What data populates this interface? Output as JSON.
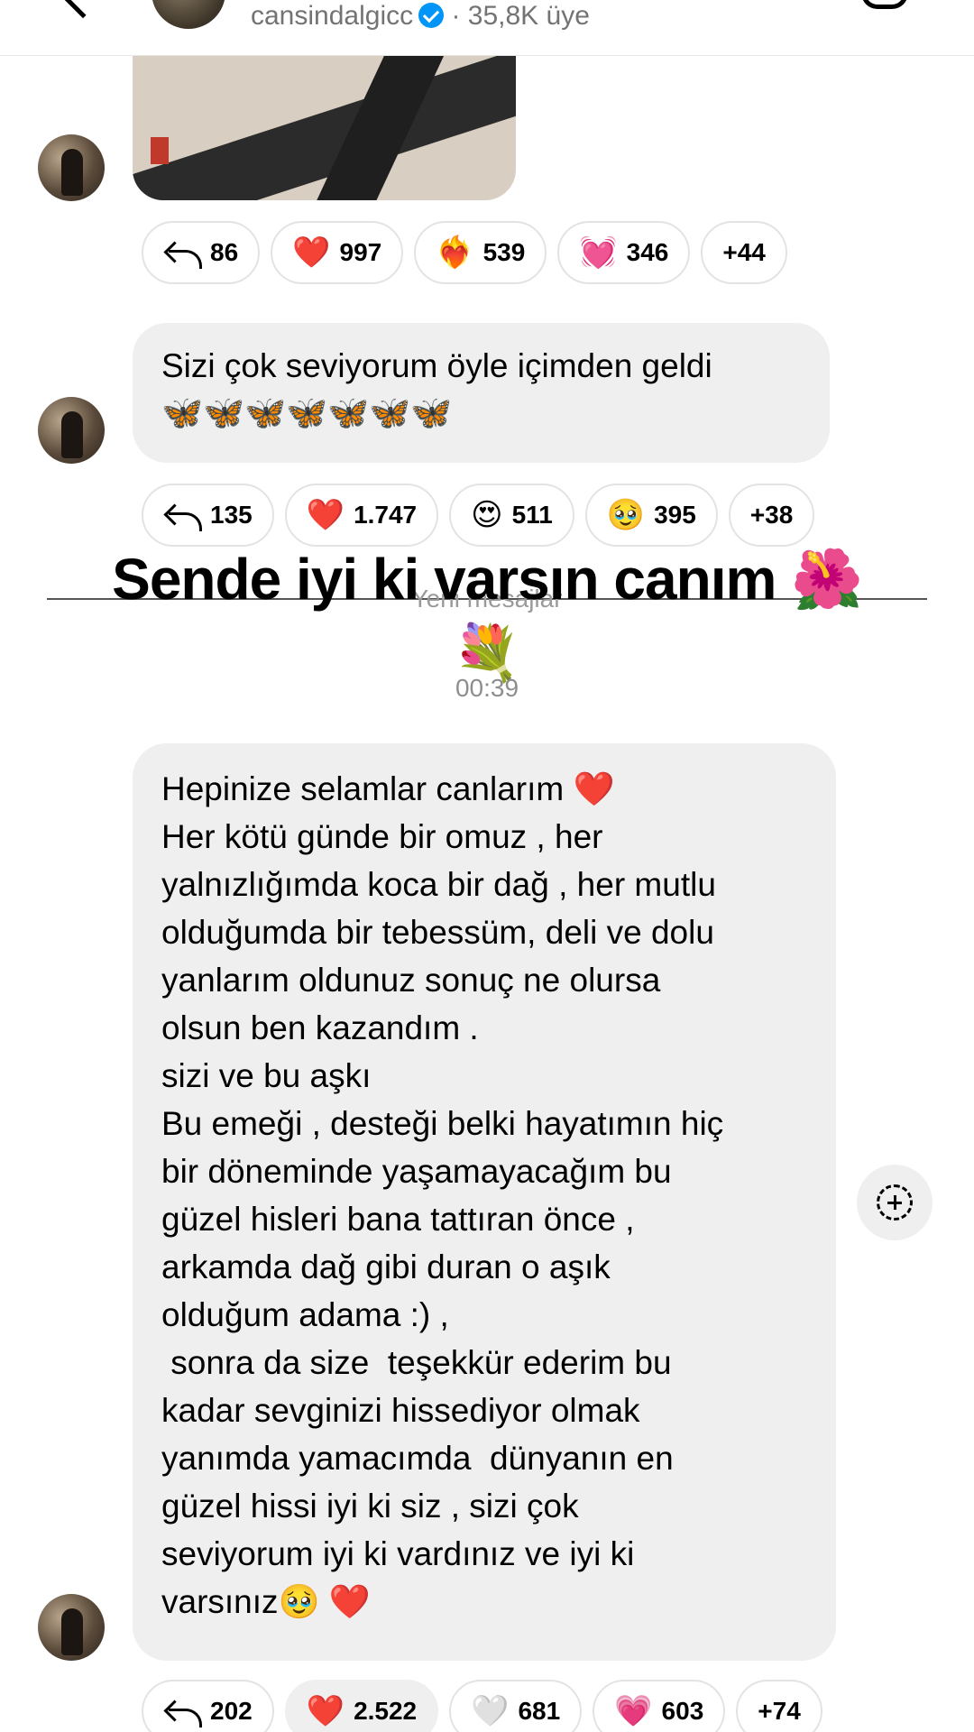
{
  "header": {
    "channel_name": "cansindalgicc",
    "separator": "·",
    "members": "35,8K üye"
  },
  "message1": {
    "reactions": [
      {
        "type": "reply",
        "count": "86"
      },
      {
        "emoji": "❤️",
        "count": "997"
      },
      {
        "emoji": "❤️‍🔥",
        "count": "539"
      },
      {
        "emoji": "💓",
        "count": "346"
      },
      {
        "more": "+44"
      }
    ]
  },
  "message2": {
    "lines": [
      "Sizi çok seviyorum öyle içimden geldi",
      "🦋🦋🦋🦋🦋🦋🦋"
    ],
    "reactions": [
      {
        "type": "reply",
        "count": "135"
      },
      {
        "emoji": "❤️",
        "count": "1.747"
      },
      {
        "emoji": "😍",
        "count": "511"
      },
      {
        "emoji": "🥹",
        "count": "395"
      },
      {
        "more": "+38"
      }
    ]
  },
  "divider": {
    "label": "Yeni mesajlar",
    "overlay_text": "Sende iyi ki varsın canım 🌺",
    "overlay_emoji": "💐",
    "timestamp": "00:39"
  },
  "message3": {
    "lines": [
      "Hepinize selamlar canlarım ❤️",
      "Her kötü günde bir omuz , her",
      "yalnızlığımda koca bir dağ , her mutlu",
      "olduğumda bir tebessüm, deli ve dolu",
      "yanlarım oldunuz sonuç ne olursa",
      "olsun ben kazandım .",
      "sizi ve bu aşkı",
      "Bu emeği , desteği belki hayatımın hiç",
      "bir döneminde yaşamayacağım bu",
      "güzel hisleri bana tattıran önce ,",
      "arkamda dağ gibi duran o aşık",
      "olduğum adama :) ,",
      " sonra da size  teşekkür ederim bu",
      "kadar sevginizi hissediyor olmak",
      "yanımda yamacımda  dünyanın en",
      "güzel hissi iyi ki siz , sizi çok",
      "seviyorum iyi ki vardınız ve iyi ki",
      "varsınız🥹 ❤️"
    ],
    "reactions": [
      {
        "type": "reply",
        "count": "202"
      },
      {
        "emoji": "❤️",
        "count": "2.522"
      },
      {
        "emoji": "🤍",
        "count": "681"
      },
      {
        "emoji": "💗",
        "count": "603"
      },
      {
        "more": "+74"
      }
    ]
  }
}
